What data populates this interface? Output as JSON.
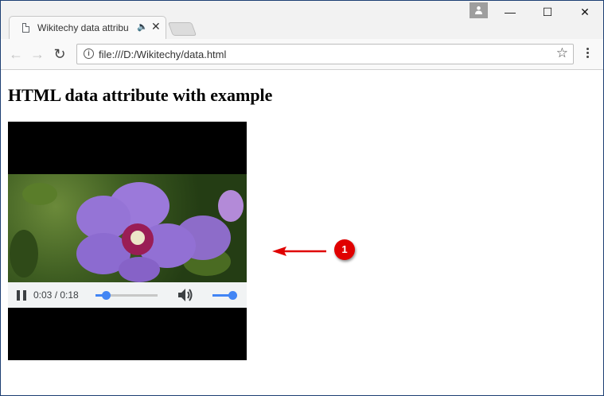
{
  "browser": {
    "tab_title": "Wikitechy data attribu",
    "tab_audio_icon": "speaker-icon",
    "tab_close": "✕",
    "address": "file:///D:/Wikitechy/data.html",
    "window_controls": {
      "minimize": "—",
      "maximize": "☐",
      "close": "✕"
    }
  },
  "page": {
    "heading": "HTML data attribute with example"
  },
  "video": {
    "current_time": "0:03",
    "duration": "0:18",
    "time_label": "0:03 / 0:18",
    "progress_fraction": 0.1667,
    "volume_fraction": 0.83,
    "state": "playing"
  },
  "annotation": {
    "marker_label": "1",
    "color": "#e00000"
  },
  "colors": {
    "accent": "#4285f4",
    "frame": "#1d3f73"
  }
}
